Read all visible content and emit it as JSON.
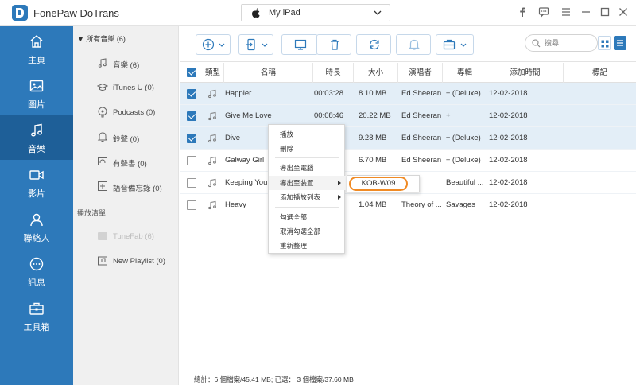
{
  "app": {
    "title": "FonePaw DoTrans"
  },
  "device": {
    "name": "My iPad"
  },
  "nav": [
    {
      "label": "主頁",
      "icon": "home-icon"
    },
    {
      "label": "圖片",
      "icon": "image-icon"
    },
    {
      "label": "音樂",
      "icon": "music-icon"
    },
    {
      "label": "影片",
      "icon": "video-icon"
    },
    {
      "label": "聯絡人",
      "icon": "contacts-icon"
    },
    {
      "label": "訊息",
      "icon": "message-icon"
    },
    {
      "label": "工具箱",
      "icon": "toolbox-icon"
    }
  ],
  "sidebar": {
    "header": "所有音樂 (6)",
    "items": [
      {
        "label": "音樂 (6)",
        "icon": "music-note-icon"
      },
      {
        "label": "iTunes U (0)",
        "icon": "graduation-cap-icon"
      },
      {
        "label": "Podcasts (0)",
        "icon": "podcast-icon"
      },
      {
        "label": "鈴聲 (0)",
        "icon": "bell-icon"
      },
      {
        "label": "有聲書 (0)",
        "icon": "audiobook-icon"
      },
      {
        "label": "語音備忘錄 (0)",
        "icon": "voice-memo-icon"
      }
    ],
    "playlist_header": "播放清單",
    "playlists": [
      {
        "label": "TuneFab (6)"
      },
      {
        "label": "New Playlist (0)"
      }
    ]
  },
  "search": {
    "placeholder": "搜尋"
  },
  "table": {
    "headers": {
      "type": "類型",
      "name": "名稱",
      "duration": "時長",
      "size": "大小",
      "artist": "演唱者",
      "album": "專輯",
      "added": "添加時間",
      "mark": "標記"
    },
    "rows": [
      {
        "checked": true,
        "name": "Happier",
        "duration": "00:03:28",
        "size": "8.10 MB",
        "artist": "Ed Sheeran",
        "album": "÷ (Deluxe)",
        "added": "12-02-2018"
      },
      {
        "checked": true,
        "name": "Give Me Love",
        "duration": "00:08:46",
        "size": "20.22 MB",
        "artist": "Ed Sheeran",
        "album": "+",
        "added": "12-02-2018"
      },
      {
        "checked": true,
        "name": "Dive",
        "duration": "",
        "size": "9.28 MB",
        "artist": "Ed Sheeran",
        "album": "÷ (Deluxe)",
        "added": "12-02-2018"
      },
      {
        "checked": false,
        "name": "Galway Girl",
        "duration": "",
        "size": "6.70 MB",
        "artist": "Ed Sheeran",
        "album": "÷ (Deluxe)",
        "added": "12-02-2018"
      },
      {
        "checked": false,
        "name": "Keeping You",
        "duration": "",
        "size": "",
        "artist": "",
        "album": "Beautiful ...",
        "added": "12-02-2018"
      },
      {
        "checked": false,
        "name": "Heavy",
        "duration": "",
        "size": "1.04 MB",
        "artist": "Theory of ...",
        "album": "Savages",
        "added": "12-02-2018"
      }
    ]
  },
  "context_menu": {
    "play": "播放",
    "delete": "刪除",
    "export_pc": "導出至電腦",
    "export_device": "導出至裝置",
    "add_playlist": "添加播放列表",
    "check_all": "勾選全部",
    "uncheck_all": "取消勾選全部",
    "refresh": "重新整理"
  },
  "submenu": {
    "device": "KOB-W09"
  },
  "status": {
    "text": "總計：6 個檔案/45.41 MB; 已選： 3 個檔案/37.60 MB"
  },
  "colors": {
    "nav_bg": "#2d79ba",
    "nav_active": "#1e5f98",
    "selected_row": "#e3eef7",
    "highlight": "#f08a24"
  }
}
